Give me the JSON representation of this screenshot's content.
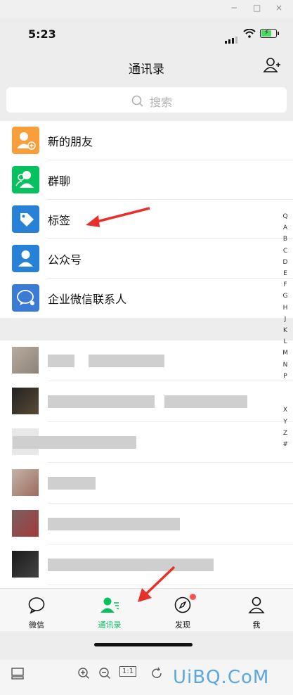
{
  "window": {
    "controls": [
      "−",
      "□",
      "×"
    ]
  },
  "status": {
    "time": "5:23"
  },
  "header": {
    "title": "通讯录"
  },
  "search": {
    "placeholder": "搜索"
  },
  "menu": [
    {
      "label": "新的朋友",
      "icon": "add-friend-icon",
      "color": "#fa9d3b"
    },
    {
      "label": "群聊",
      "icon": "group-icon",
      "color": "#07c160"
    },
    {
      "label": "标签",
      "icon": "tag-icon",
      "color": "#2782d7"
    },
    {
      "label": "公众号",
      "icon": "official-account-icon",
      "color": "#2782d7"
    },
    {
      "label": "企业微信联系人",
      "icon": "wecom-icon",
      "color": "#3a7bd5"
    }
  ],
  "alpha_index": [
    "Q",
    "A",
    "B",
    "C",
    "D",
    "E",
    "F",
    "G",
    "H",
    "J",
    "K",
    "L",
    "M",
    "N",
    "P",
    "",
    "",
    "X",
    "Y",
    "Z",
    "#"
  ],
  "tabs": [
    {
      "label": "微信",
      "icon": "chat-icon"
    },
    {
      "label": "通讯录",
      "icon": "contacts-icon",
      "active": true
    },
    {
      "label": "发现",
      "icon": "discover-icon"
    },
    {
      "label": "我",
      "icon": "me-icon"
    }
  ],
  "toolbar": {
    "zoom_label": "1:1"
  },
  "watermark": "UiBQ.CoM",
  "colors": {
    "accent": "#07c160",
    "badge": "#fa5151",
    "arrow": "#e8302a"
  }
}
